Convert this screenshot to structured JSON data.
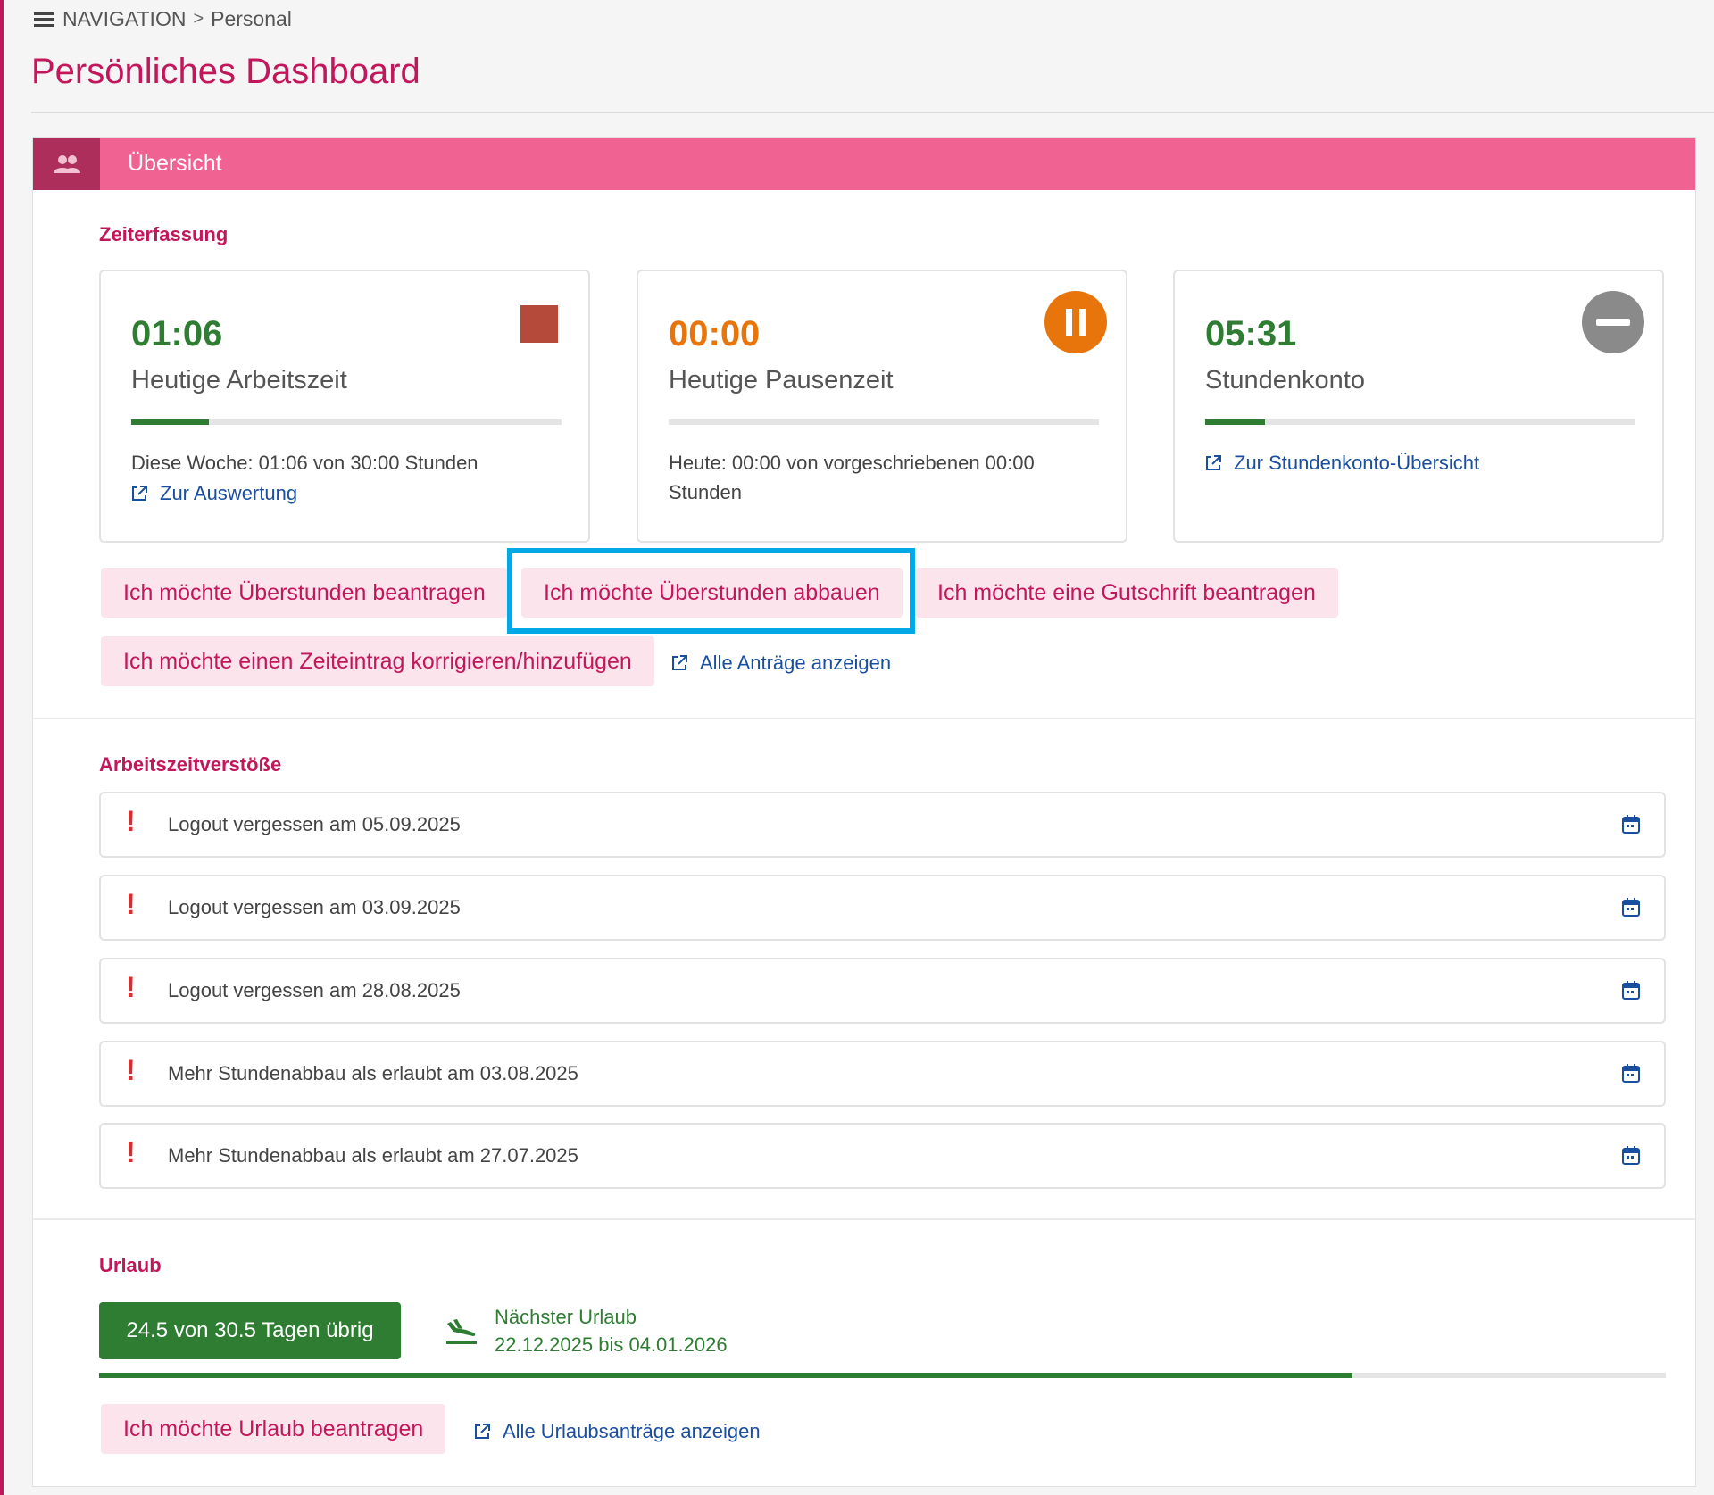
{
  "breadcrumb": {
    "root": "NAVIGATION",
    "separator": ">",
    "current": "Personal"
  },
  "page": {
    "title": "Persönliches Dashboard"
  },
  "card": {
    "header_title": "Übersicht"
  },
  "time_tracking": {
    "section_title": "Zeiterfassung",
    "work": {
      "value": "01:06",
      "label": "Heutige Arbeitszeit",
      "progress": 0.18,
      "info": "Diese Woche: 01:06 von 30:00 Stunden",
      "link": "Zur Auswertung",
      "action_icon": "stop-icon",
      "color": "#2e7d32"
    },
    "pause": {
      "value": "00:00",
      "label": "Heutige Pausenzeit",
      "progress": 0,
      "info": "Heute: 00:00 von vorgeschriebenen 00:00 Stunden",
      "action_icon": "pause-icon",
      "color": "#e8740c"
    },
    "balance": {
      "value": "05:31",
      "label": "Stundenkonto",
      "progress": 0.14,
      "link": "Zur Stundenkonto-Übersicht",
      "action_icon": "minus-icon",
      "color": "#2e7d32"
    },
    "actions": {
      "request_overtime": "Ich möchte Überstunden beantragen",
      "reduce_overtime": "Ich möchte Überstunden abbauen",
      "request_credit": "Ich möchte eine Gutschrift beantragen",
      "correct_entry": "Ich möchte einen Zeiteintrag korrigieren/hinzufügen",
      "all_requests": "Alle Anträge anzeigen"
    }
  },
  "violations": {
    "section_title": "Arbeitszeitverstöße",
    "items": [
      {
        "text": "Logout vergessen am 05.09.2025"
      },
      {
        "text": "Logout vergessen am 03.09.2025"
      },
      {
        "text": "Logout vergessen am 28.08.2025"
      },
      {
        "text": "Mehr Stundenabbau als erlaubt am 03.08.2025"
      },
      {
        "text": "Mehr Stundenabbau als erlaubt am 27.07.2025"
      }
    ],
    "marker": "!"
  },
  "vacation": {
    "section_title": "Urlaub",
    "remaining": "24.5 von 30.5 Tagen übrig",
    "remaining_fraction": 0.8,
    "next_label": "Nächster Urlaub",
    "next_range": "22.12.2025 bis 04.01.2026",
    "request_button": "Ich möchte Urlaub beantragen",
    "all_requests": "Alle Urlaubsanträge anzeigen"
  },
  "colors": {
    "brand": "#c2185b",
    "header": "#f06292",
    "green": "#2e7d32",
    "orange": "#e8740c",
    "link": "#1a4fa0",
    "highlight": "#03a9e6"
  }
}
